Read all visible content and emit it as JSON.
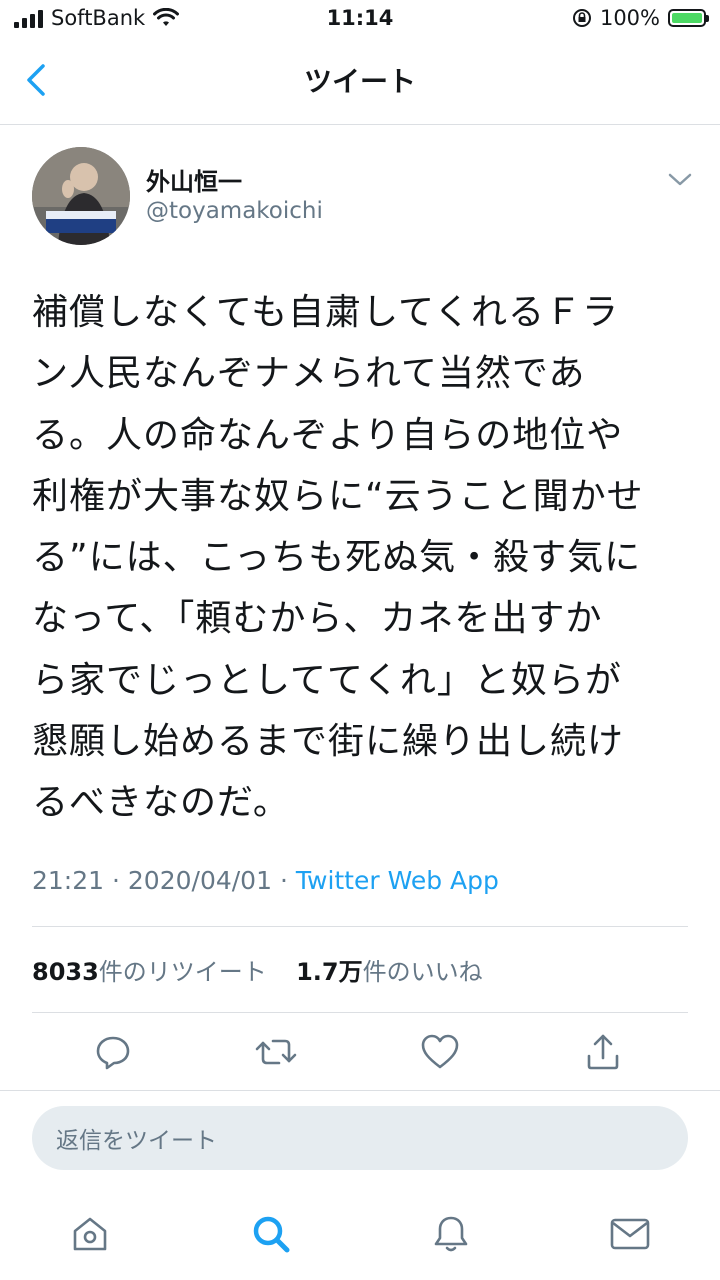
{
  "status_bar": {
    "carrier": "SoftBank",
    "time": "11:14",
    "battery": "100%"
  },
  "nav": {
    "title": "ツイート",
    "back_icon": "chevron-left-icon"
  },
  "tweet": {
    "author_name": "外山恒一",
    "author_handle": "@toyamakoichi",
    "avatar_caption": "外山恒一",
    "body_lines": [
      "補償しなくても自粛してくれるＦラ",
      "ン人民なんぞナメられて当然であ",
      "る。人の命なんぞより自らの地位や",
      "利権が大事な奴らに“云うこと聞かせ",
      "る”には、こっちも死ぬ気・殺す気に",
      "なって、「頼むから、カネを出すか",
      "ら家でじっとしててくれ」と奴らが",
      "懇願し始めるまで街に繰り出し続け",
      "るべきなのだ。"
    ],
    "time": "21:21",
    "date": "2020/04/01",
    "source": "Twitter Web App",
    "retweet_count": "8033",
    "retweet_label": "件のリツイート",
    "like_count": "1.7万",
    "like_label": "件のいいね"
  },
  "actions": {
    "reply_icon": "reply-icon",
    "retweet_icon": "retweet-icon",
    "like_icon": "heart-icon",
    "share_icon": "share-icon"
  },
  "reply": {
    "placeholder": "返信をツイート"
  },
  "tabbar": {
    "items": [
      "home-icon",
      "search-icon",
      "notifications-icon",
      "messages-icon"
    ],
    "active": "search-icon"
  },
  "colors": {
    "accent": "#1da1f2",
    "text": "#14171a",
    "secondary": "#657786",
    "battery": "#4cd964"
  }
}
